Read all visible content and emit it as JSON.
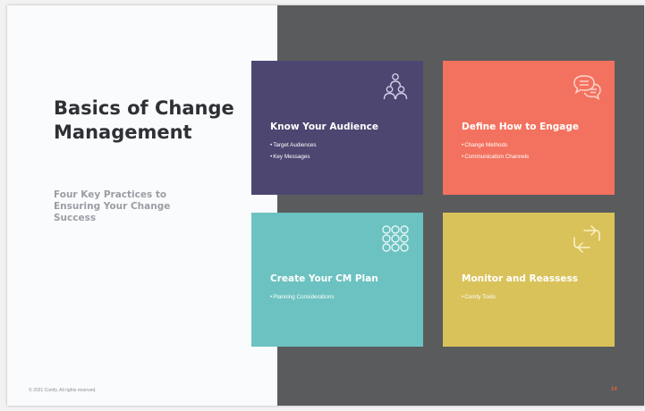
{
  "slide": {
    "title": "Basics of Change Management",
    "subtitle": "Four Key Practices to Ensuring Your Change Success",
    "copyright": "© 2021 Comfy. All rights reserved.",
    "page_number": "14"
  },
  "cards": [
    {
      "title": "Know Your Audience",
      "items": [
        "Target Audiences",
        "Key Messages"
      ],
      "icon": "people-group-icon",
      "color": "#4c4670"
    },
    {
      "title": "Define How to Engage",
      "items": [
        "Change Methods",
        "Communication Channels"
      ],
      "icon": "chat-bubbles-icon",
      "color": "#f3725f"
    },
    {
      "title": "Create Your CM Plan",
      "items": [
        "Planning Considerations"
      ],
      "icon": "dot-grid-icon",
      "color": "#6cc2c0"
    },
    {
      "title": "Monitor and Reassess",
      "items": [
        "Comfy Tools"
      ],
      "icon": "cycle-arrows-icon",
      "color": "#d9c25a"
    }
  ],
  "colors": {
    "dark_panel": "#5a5b5d",
    "title_text": "#2f3035",
    "subtitle_text": "#9a9ea4",
    "accent": "#e8603c"
  }
}
